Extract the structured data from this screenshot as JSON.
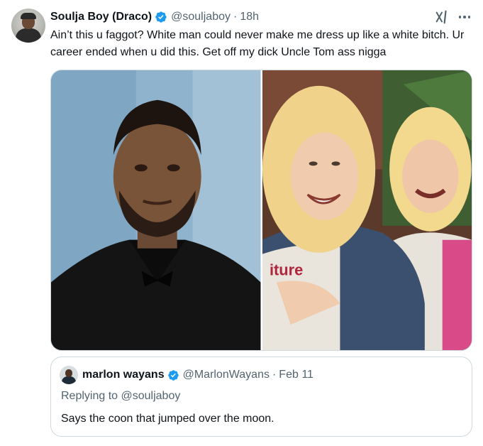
{
  "tweet": {
    "author_name": "Soulja Boy (Draco)",
    "handle": "@souljaboy",
    "separator": "·",
    "time": "18h",
    "text": "Ain’t this u faggot? White man could never make me dress up like a white bitch. Ur career ended when u did this. Get off my dick Uncle Tom ass nigga"
  },
  "icons": {
    "verified": "verified-badge-icon",
    "grok": "grok-icon",
    "more": "more-icon"
  },
  "colors": {
    "verified_blue": "#1d9bf0",
    "secondary_text": "#536471",
    "border": "#cfd9de"
  },
  "quote": {
    "author_name": "marlon wayans",
    "handle": "@MarlonWayans",
    "separator": "·",
    "date": "Feb 11",
    "replying_prefix": "Replying to ",
    "replying_to": "@souljaboy",
    "text": "Says the coon that jumped over the moon."
  }
}
